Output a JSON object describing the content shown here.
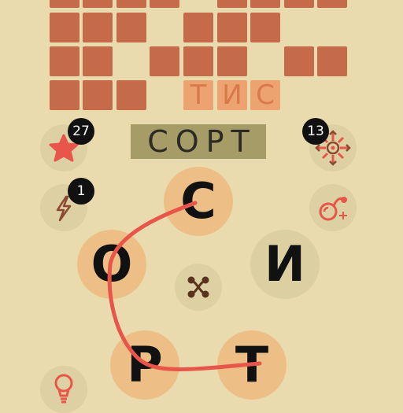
{
  "partial_word": {
    "letters": [
      "Т",
      "И",
      "С"
    ]
  },
  "current_word": "СОРТ",
  "star_count": "27",
  "bolt_count": "1",
  "shuffle_target_count": "13",
  "wheel": {
    "letters": [
      "С",
      "О",
      "И",
      "Р",
      "Т"
    ]
  },
  "colors": {
    "background": "#e9dbad",
    "tile": "#c56b4a",
    "accent": "#e8554a"
  },
  "icons": [
    "star-icon",
    "lightning-icon",
    "target-icon",
    "bomb-icon",
    "shuffle-icon",
    "lightbulb-icon"
  ]
}
